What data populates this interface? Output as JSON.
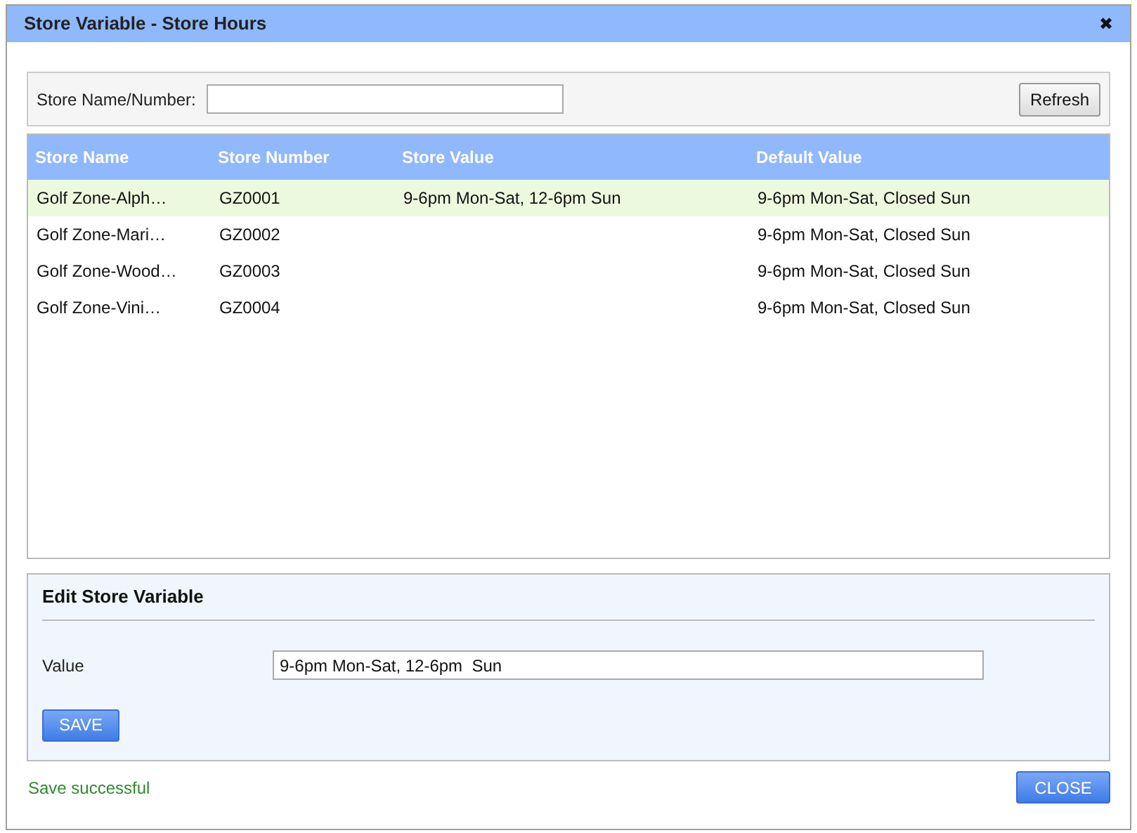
{
  "window": {
    "title": "Store Variable - Store Hours",
    "close_icon": "✖"
  },
  "search": {
    "label": "Store Name/Number:",
    "button": "Refresh"
  },
  "table": {
    "columns": [
      "Store Name",
      "Store Number",
      "Store Value",
      "Default Value"
    ],
    "rows": [
      {
        "cells": [
          "Golf Zone-Alph…",
          "GZ0001",
          "9-6pm Mon-Sat, 12-6pm  Sun",
          "9-6pm Mon-Sat, Closed Sun"
        ],
        "selected": true
      },
      {
        "cells": [
          "Golf Zone-Mari…",
          "GZ0002",
          "",
          "9-6pm Mon-Sat, Closed Sun"
        ],
        "selected": false
      },
      {
        "cells": [
          "Golf Zone-Wood…",
          "GZ0003",
          "",
          "9-6pm Mon-Sat, Closed Sun"
        ],
        "selected": false
      },
      {
        "cells": [
          "Golf Zone-Vini…",
          "GZ0004",
          "",
          "9-6pm Mon-Sat, Closed Sun"
        ],
        "selected": false
      }
    ]
  },
  "edit": {
    "title": "Edit Store Variable",
    "label": "Value",
    "value": "9-6pm Mon-Sat, 12-6pm  Sun",
    "button": "SAVE"
  },
  "status": "Save successful",
  "close_button": "CLOSE"
}
